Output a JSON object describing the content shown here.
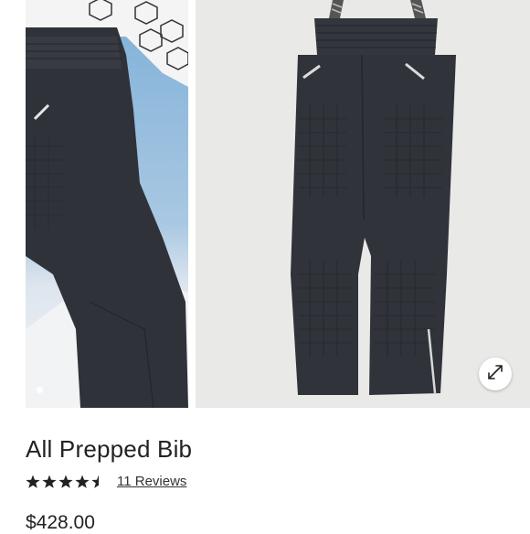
{
  "product": {
    "title": "All Prepped Bib",
    "rating": 4.5,
    "reviews_label": "11 Reviews",
    "price": "$428.00"
  },
  "gallery": {
    "active_index": 0,
    "expand_icon": "expand-arrows-icon"
  },
  "colors": {
    "fabric": "#2e3138",
    "background": "#ffffff"
  }
}
